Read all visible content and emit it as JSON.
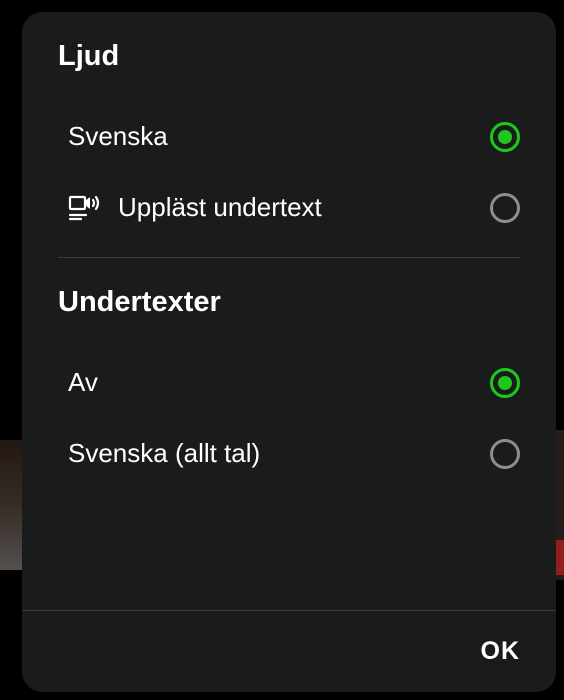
{
  "audio": {
    "title": "Ljud",
    "options": [
      {
        "label": "Svenska",
        "selected": true,
        "hasIcon": false
      },
      {
        "label": "Uppläst undertext",
        "selected": false,
        "hasIcon": true
      }
    ]
  },
  "subtitles": {
    "title": "Undertexter",
    "options": [
      {
        "label": "Av",
        "selected": true
      },
      {
        "label": "Svenska (allt tal)",
        "selected": false
      }
    ]
  },
  "footer": {
    "ok_label": "OK"
  }
}
